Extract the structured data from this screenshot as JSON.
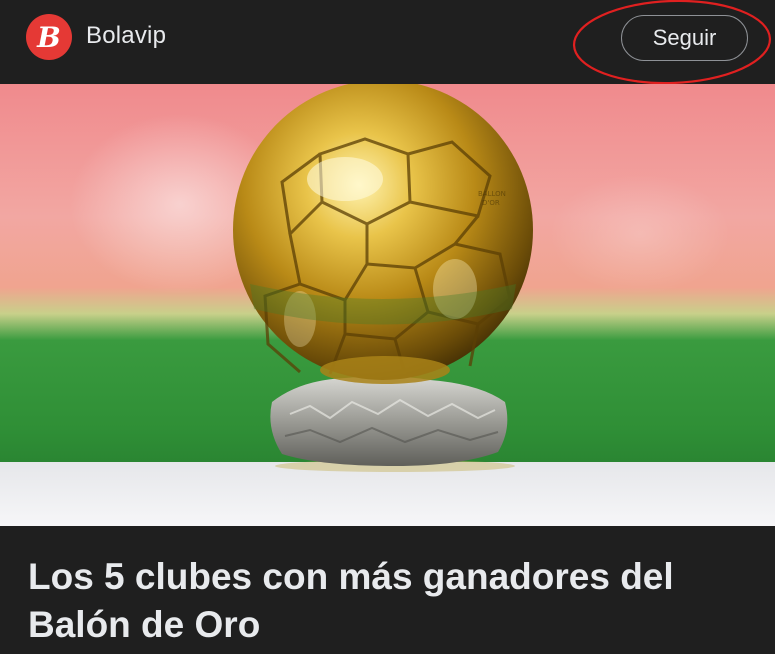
{
  "header": {
    "logo": {
      "icon": "bolavip-logo-icon",
      "letter": "B",
      "color": "#e53935"
    },
    "brand": "Bolavip",
    "follow_label": "Seguir"
  },
  "hero": {
    "image": "ballon-d-or-trophy-image"
  },
  "article": {
    "title": "Los 5 clubes con más ganadores del Balón de Oro"
  },
  "colors": {
    "background": "#1f1f1f",
    "text": "#e8eaed",
    "annotation": "#e02020"
  }
}
